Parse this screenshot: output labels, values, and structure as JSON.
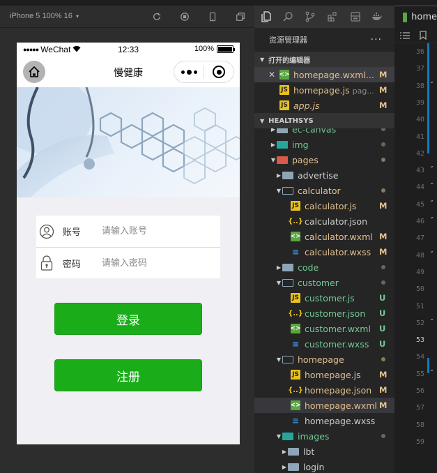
{
  "simulator": {
    "device_label": "iPhone 5 100% 16",
    "caret": "▾"
  },
  "phone": {
    "statusbar": {
      "signal": "●●●●●",
      "carrier": "WeChat",
      "time": "12:33",
      "battery": "100%"
    },
    "navbar": {
      "title": "慢健康"
    },
    "form": {
      "account_label": "账号",
      "account_placeholder": "请输入账号",
      "password_label": "密码",
      "password_placeholder": "请输入密码"
    },
    "buttons": {
      "login": "登录",
      "register": "注册"
    }
  },
  "editor_tab": {
    "label": "home"
  },
  "explorer": {
    "title": "资源管理器",
    "more": "···",
    "open_editors_label": "打开的编辑器",
    "open_editors": [
      {
        "name": "homepage.wxml...",
        "type": "wxml",
        "status": "M",
        "closable": true
      },
      {
        "name": "homepage.js",
        "hint": "pag...",
        "type": "js",
        "status": "M"
      },
      {
        "name": "app.js",
        "type": "js",
        "status": "M"
      }
    ],
    "project_label": "HEALTHSYS",
    "tree": [
      {
        "name": "ec-canvas",
        "type": "folder"
      },
      {
        "name": "img",
        "type": "folder"
      },
      {
        "name": "pages",
        "type": "folder"
      },
      {
        "name": "advertise",
        "type": "folder"
      },
      {
        "name": "calculator",
        "type": "folder"
      },
      {
        "name": "calculator.js",
        "type": "js",
        "status": "M"
      },
      {
        "name": "calculator.json",
        "type": "json"
      },
      {
        "name": "calculator.wxml",
        "type": "wxml",
        "status": "M"
      },
      {
        "name": "calculator.wxss",
        "type": "wxss",
        "status": "M"
      },
      {
        "name": "code",
        "type": "folder"
      },
      {
        "name": "customer",
        "type": "folder"
      },
      {
        "name": "customer.js",
        "type": "js",
        "status": "U"
      },
      {
        "name": "customer.json",
        "type": "json",
        "status": "U"
      },
      {
        "name": "customer.wxml",
        "type": "wxml",
        "status": "U"
      },
      {
        "name": "customer.wxss",
        "type": "wxss",
        "status": "U"
      },
      {
        "name": "homepage",
        "type": "folder"
      },
      {
        "name": "homepage.js",
        "type": "js",
        "status": "M"
      },
      {
        "name": "homepage.json",
        "type": "json",
        "status": "M"
      },
      {
        "name": "homepage.wxml",
        "type": "wxml",
        "status": "M"
      },
      {
        "name": "homepage.wxss",
        "type": "wxss"
      },
      {
        "name": "images",
        "type": "folder"
      },
      {
        "name": "lbt",
        "type": "folder"
      },
      {
        "name": "login",
        "type": "folder"
      }
    ]
  },
  "gutter": {
    "line_numbers": [
      "36",
      "37",
      "38",
      "39",
      "40",
      "41",
      "42",
      "43",
      "44",
      "45",
      "46",
      "47",
      "48",
      "49",
      "50",
      "51",
      "52",
      "53",
      "54",
      "55",
      "56",
      "57",
      "58",
      "59"
    ],
    "current_line": "53"
  }
}
